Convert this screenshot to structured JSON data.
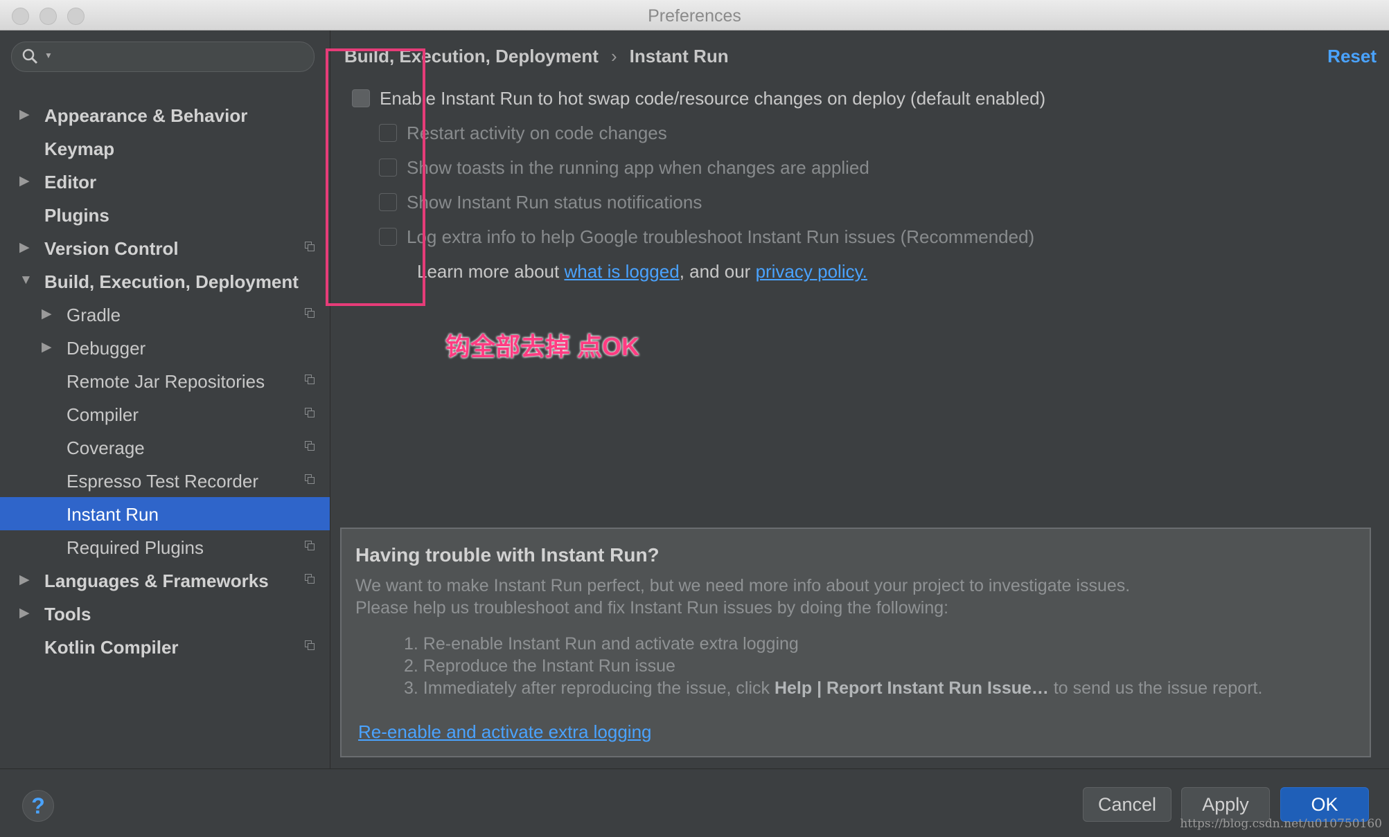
{
  "window": {
    "title": "Preferences"
  },
  "sidebar": {
    "search_placeholder": "",
    "items": [
      {
        "label": "Appearance & Behavior",
        "level": 0,
        "arrow": "right",
        "bold": true,
        "project_icon": false,
        "selected": false
      },
      {
        "label": "Keymap",
        "level": 0,
        "arrow": "none",
        "bold": true,
        "project_icon": false,
        "selected": false
      },
      {
        "label": "Editor",
        "level": 0,
        "arrow": "right",
        "bold": true,
        "project_icon": false,
        "selected": false
      },
      {
        "label": "Plugins",
        "level": 0,
        "arrow": "none",
        "bold": true,
        "project_icon": false,
        "selected": false
      },
      {
        "label": "Version Control",
        "level": 0,
        "arrow": "right",
        "bold": true,
        "project_icon": true,
        "selected": false
      },
      {
        "label": "Build, Execution, Deployment",
        "level": 0,
        "arrow": "down",
        "bold": true,
        "project_icon": false,
        "selected": false
      },
      {
        "label": "Gradle",
        "level": 1,
        "arrow": "right",
        "bold": false,
        "project_icon": true,
        "selected": false
      },
      {
        "label": "Debugger",
        "level": 1,
        "arrow": "right",
        "bold": false,
        "project_icon": false,
        "selected": false
      },
      {
        "label": "Remote Jar Repositories",
        "level": 1,
        "arrow": "none",
        "bold": false,
        "project_icon": true,
        "selected": false
      },
      {
        "label": "Compiler",
        "level": 1,
        "arrow": "none",
        "bold": false,
        "project_icon": true,
        "selected": false
      },
      {
        "label": "Coverage",
        "level": 1,
        "arrow": "none",
        "bold": false,
        "project_icon": true,
        "selected": false
      },
      {
        "label": "Espresso Test Recorder",
        "level": 1,
        "arrow": "none",
        "bold": false,
        "project_icon": true,
        "selected": false
      },
      {
        "label": "Instant Run",
        "level": 1,
        "arrow": "none",
        "bold": false,
        "project_icon": false,
        "selected": true
      },
      {
        "label": "Required Plugins",
        "level": 1,
        "arrow": "none",
        "bold": false,
        "project_icon": true,
        "selected": false
      },
      {
        "label": "Languages & Frameworks",
        "level": 0,
        "arrow": "right",
        "bold": true,
        "project_icon": true,
        "selected": false
      },
      {
        "label": "Tools",
        "level": 0,
        "arrow": "right",
        "bold": true,
        "project_icon": false,
        "selected": false
      },
      {
        "label": "Kotlin Compiler",
        "level": 0,
        "arrow": "none",
        "bold": true,
        "project_icon": true,
        "selected": false
      }
    ]
  },
  "content": {
    "breadcrumb": {
      "parent": "Build, Execution, Deployment",
      "separator": "›",
      "current": "Instant Run"
    },
    "reset_label": "Reset",
    "main_checkbox": {
      "label": "Enable Instant Run to hot swap code/resource changes on deploy (default enabled)",
      "checked": false
    },
    "sub_checkboxes": [
      {
        "label": "Restart activity on code changes",
        "checked": false
      },
      {
        "label": "Show toasts in the running app when changes are applied",
        "checked": false
      },
      {
        "label": "Show Instant Run status notifications",
        "checked": false
      },
      {
        "label": "Log extra info to help Google troubleshoot Instant Run issues (Recommended)",
        "checked": false
      }
    ],
    "learn_more": {
      "prefix": "Learn more about ",
      "link1": "what is logged",
      "middle": ", and our ",
      "link2": "privacy policy."
    },
    "annotation": "钩全部去掉 点OK",
    "trouble_panel": {
      "title": "Having trouble with Instant Run?",
      "line1": "We want to make Instant Run perfect, but we need more info about your project to investigate issues.",
      "line2": "Please help us troubleshoot and fix Instant Run issues by doing the following:",
      "step1": "1. Re-enable Instant Run and activate extra logging",
      "step2": "2. Reproduce the Instant Run issue",
      "step3_prefix": "3. Immediately after reproducing the issue, click ",
      "step3_bold": "Help | Report Instant Run Issue…",
      "step3_suffix": " to send us the issue report.",
      "link": "Re-enable and activate extra logging"
    }
  },
  "footer": {
    "help_label": "?",
    "cancel_label": "Cancel",
    "apply_label": "Apply",
    "ok_label": "OK",
    "watermark": "https://blog.csdn.net/u010750160"
  },
  "colors": {
    "accent_selection": "#2f65ca",
    "link": "#4aa3ff",
    "annotation": "#ff3c82",
    "ok_button": "#1f5fb8"
  }
}
